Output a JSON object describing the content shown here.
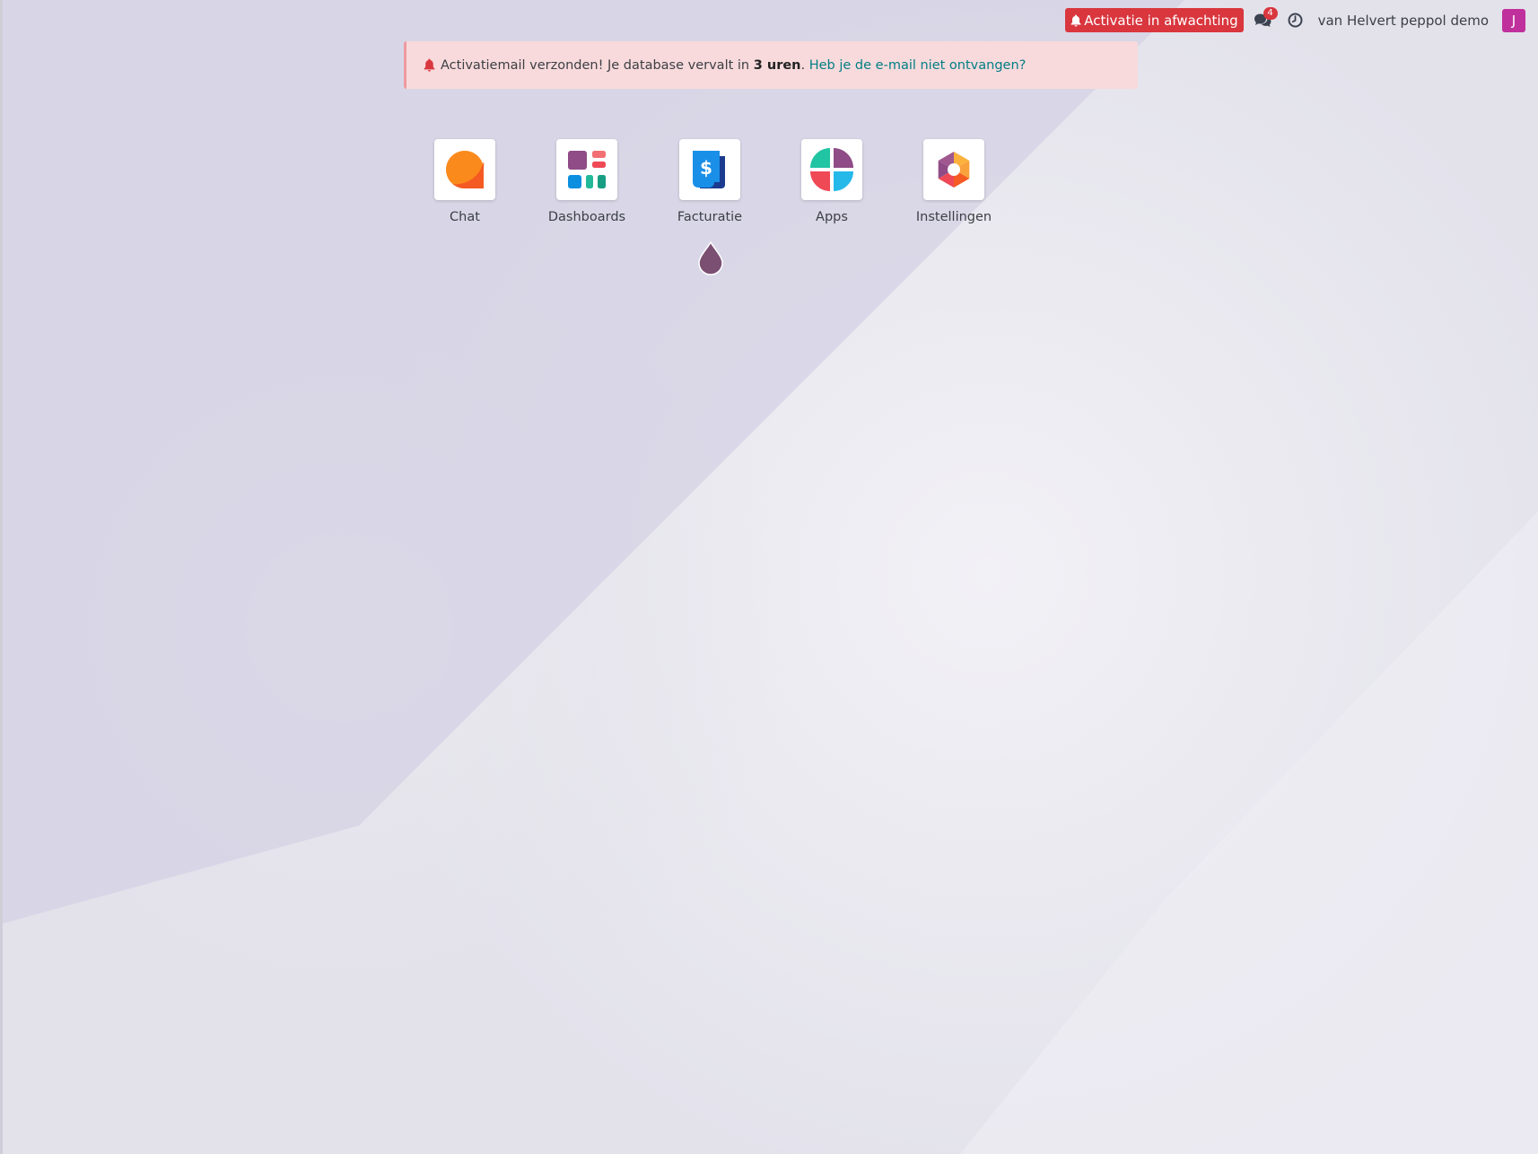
{
  "topbar": {
    "activation_label": "Activatie in afwachting",
    "chat_count": "4",
    "company_name": "van Helvert peppol demo",
    "avatar_initial": "J"
  },
  "alert": {
    "text_before": "Activatiemail verzonden! Je database vervalt in ",
    "bold_text": "3 uren",
    "text_after": ". ",
    "link_text": "Heb je de e-mail niet ontvangen?"
  },
  "apps": [
    {
      "label": "Chat",
      "icon": "chat-app-icon"
    },
    {
      "label": "Dashboards",
      "icon": "dashboards-app-icon"
    },
    {
      "label": "Facturatie",
      "icon": "invoicing-app-icon"
    },
    {
      "label": "Apps",
      "icon": "apps-app-icon"
    },
    {
      "label": "Instellingen",
      "icon": "settings-app-icon"
    }
  ],
  "colors": {
    "danger": "#d9363e",
    "link": "#017e84",
    "avatar": "#c0309c",
    "alert_bg": "#f8dadc",
    "drop": "#7a4f72"
  }
}
